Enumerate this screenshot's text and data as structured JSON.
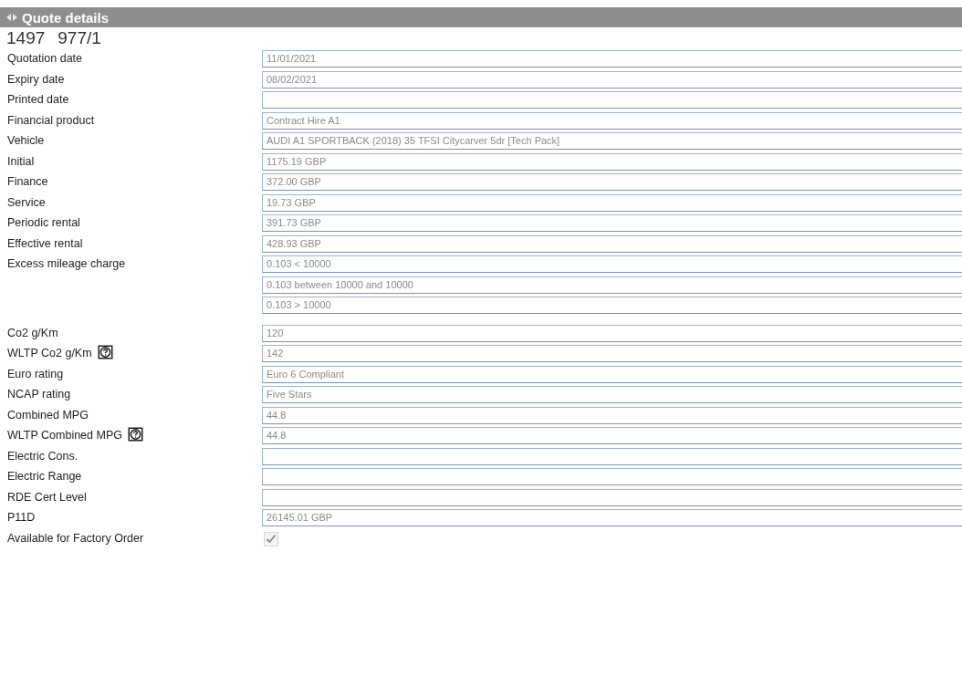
{
  "header": {
    "title": "Quote details"
  },
  "reference": [
    "1497",
    "977/1"
  ],
  "fields": [
    {
      "label": "Quotation date",
      "kind": "text",
      "values": [
        "11/01/2021"
      ]
    },
    {
      "label": "Expiry date",
      "kind": "text",
      "values": [
        "08/02/2021"
      ]
    },
    {
      "label": "Printed date",
      "kind": "text"
    },
    {
      "label": "Financial product",
      "kind": "text",
      "values": [
        "Contract Hire A1"
      ]
    },
    {
      "label": "Vehicle",
      "kind": "text",
      "values": [
        "AUDI A1 SPORTBACK (2018) 35 TFSI Citycarver 5dr [Tech Pack]"
      ]
    },
    {
      "label": "Initial",
      "kind": "text",
      "values": [
        "1175.19 GBP"
      ]
    },
    {
      "label": "Finance",
      "kind": "text",
      "values": [
        "372.00 GBP"
      ]
    },
    {
      "label": "Service",
      "kind": "text",
      "values": [
        "19.73 GBP"
      ]
    },
    {
      "label": "Periodic rental",
      "kind": "text",
      "values": [
        "391.73 GBP"
      ]
    },
    {
      "label": "Effective rental",
      "kind": "text",
      "values": [
        "428.93 GBP"
      ]
    },
    {
      "label": "Excess mileage charge",
      "kind": "text",
      "values": [
        "0.103 < 10000",
        "0.103 between 10000 and  10000",
        "0.103 > 10000"
      ]
    },
    {
      "label": "Co2 g/Km",
      "kind": "text",
      "values": [
        "120"
      ]
    },
    {
      "label": "WLTP Co2 g/Km",
      "kind": "text",
      "help": true,
      "values": [
        "142"
      ]
    },
    {
      "label": "Euro rating",
      "kind": "text",
      "values": [
        "Euro 6 Compliant"
      ]
    },
    {
      "label": "NCAP rating",
      "kind": "text",
      "values": [
        "Five Stars"
      ]
    },
    {
      "label": "Combined MPG",
      "kind": "text",
      "values": [
        "44.8"
      ]
    },
    {
      "label": "WLTP Combined MPG",
      "kind": "text",
      "help": true,
      "values": [
        "44.8"
      ]
    },
    {
      "label": "Electric Cons.",
      "kind": "text"
    },
    {
      "label": "Electric Range",
      "kind": "text"
    },
    {
      "label": "RDE Cert Level",
      "kind": "text"
    },
    {
      "label": "P11D",
      "kind": "text",
      "values": [
        "26145.01 GBP"
      ]
    },
    {
      "label": "Available for Factory Order",
      "kind": "checkbox",
      "checked": true
    }
  ]
}
